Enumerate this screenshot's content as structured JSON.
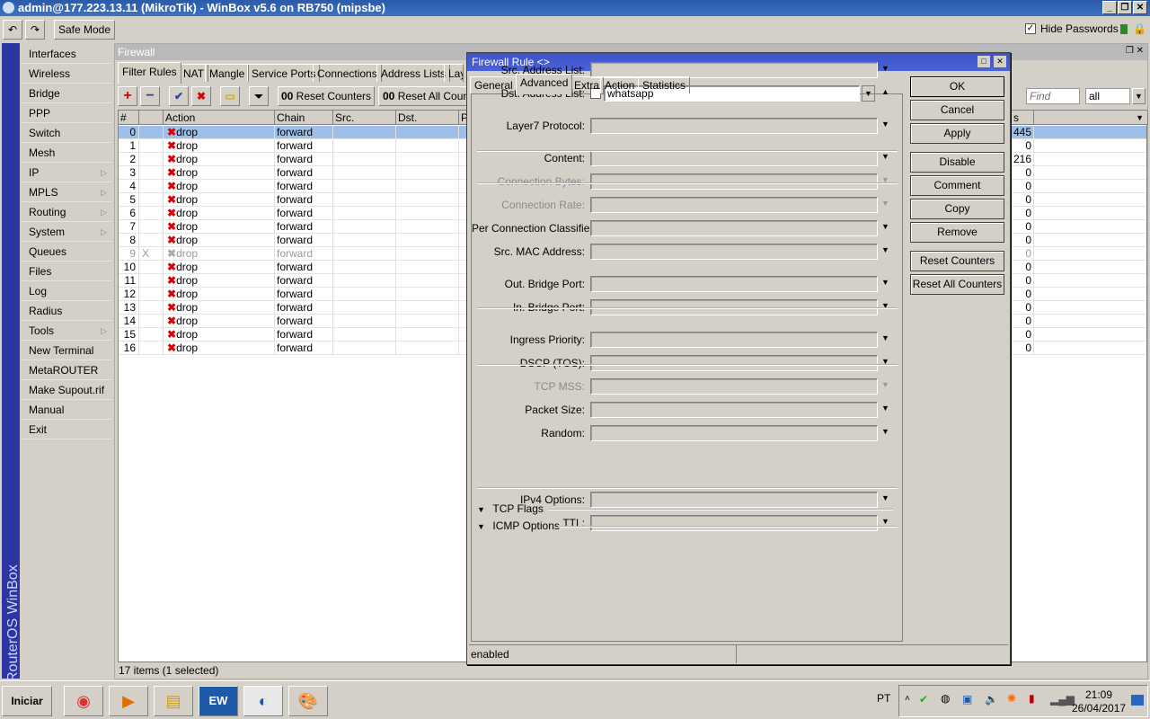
{
  "window": {
    "title": "admin@177.223.13.11 (MikroTik) - WinBox v5.6 on RB750 (mipsbe)"
  },
  "toolbar": {
    "safe_mode": "Safe Mode",
    "hide_passwords": "Hide Passwords",
    "hide_passwords_checked": true
  },
  "brand": "RouterOS WinBox",
  "menu": [
    {
      "label": "Interfaces"
    },
    {
      "label": "Wireless"
    },
    {
      "label": "Bridge"
    },
    {
      "label": "PPP"
    },
    {
      "label": "Switch"
    },
    {
      "label": "Mesh"
    },
    {
      "label": "IP",
      "sub": true
    },
    {
      "label": "MPLS",
      "sub": true
    },
    {
      "label": "Routing",
      "sub": true
    },
    {
      "label": "System",
      "sub": true
    },
    {
      "label": "Queues"
    },
    {
      "label": "Files"
    },
    {
      "label": "Log"
    },
    {
      "label": "Radius"
    },
    {
      "label": "Tools",
      "sub": true
    },
    {
      "label": "New Terminal"
    },
    {
      "label": "MetaROUTER"
    },
    {
      "label": "Make Supout.rif"
    },
    {
      "label": "Manual"
    },
    {
      "label": "Exit"
    }
  ],
  "firewall": {
    "title": "Firewall",
    "tabs": [
      "Filter Rules",
      "NAT",
      "Mangle",
      "Service Ports",
      "Connections",
      "Address Lists",
      "Layer7 Protocols"
    ],
    "reset_counters": "Reset Counters",
    "reset_all_counters": "Reset All Counters",
    "counter_prefix": "00",
    "find_placeholder": "Find",
    "filter_value": "all",
    "columns": [
      "#",
      "",
      "Action",
      "Chain",
      "Src. Address",
      "Dst. Address",
      "P",
      "Bytes"
    ],
    "rows": [
      {
        "n": "0",
        "flag": "",
        "action": "drop",
        "chain": "forward",
        "bytes": "445",
        "selected": true
      },
      {
        "n": "1",
        "flag": "",
        "action": "drop",
        "chain": "forward",
        "bytes": "0"
      },
      {
        "n": "2",
        "flag": "",
        "action": "drop",
        "chain": "forward",
        "bytes": "216"
      },
      {
        "n": "3",
        "flag": "",
        "action": "drop",
        "chain": "forward",
        "bytes": "0"
      },
      {
        "n": "4",
        "flag": "",
        "action": "drop",
        "chain": "forward",
        "bytes": "0"
      },
      {
        "n": "5",
        "flag": "",
        "action": "drop",
        "chain": "forward",
        "bytes": "0"
      },
      {
        "n": "6",
        "flag": "",
        "action": "drop",
        "chain": "forward",
        "bytes": "0"
      },
      {
        "n": "7",
        "flag": "",
        "action": "drop",
        "chain": "forward",
        "bytes": "0"
      },
      {
        "n": "8",
        "flag": "",
        "action": "drop",
        "chain": "forward",
        "bytes": "0"
      },
      {
        "n": "9",
        "flag": "X",
        "action": "drop",
        "chain": "forward",
        "bytes": "0",
        "disabled": true
      },
      {
        "n": "10",
        "flag": "",
        "action": "drop",
        "chain": "forward",
        "bytes": "0"
      },
      {
        "n": "11",
        "flag": "",
        "action": "drop",
        "chain": "forward",
        "bytes": "0"
      },
      {
        "n": "12",
        "flag": "",
        "action": "drop",
        "chain": "forward",
        "bytes": "0"
      },
      {
        "n": "13",
        "flag": "",
        "action": "drop",
        "chain": "forward",
        "bytes": "0"
      },
      {
        "n": "14",
        "flag": "",
        "action": "drop",
        "chain": "forward",
        "bytes": "0"
      },
      {
        "n": "15",
        "flag": "",
        "action": "drop",
        "chain": "forward",
        "bytes": "0"
      },
      {
        "n": "16",
        "flag": "",
        "action": "drop",
        "chain": "forward",
        "bytes": "0"
      }
    ],
    "status": "17 items (1 selected)"
  },
  "dialog": {
    "title": "Firewall Rule <>",
    "tabs": [
      "General",
      "Advanced",
      "Extra",
      "Action",
      "Statistics"
    ],
    "active_tab": "Advanced",
    "fields": [
      {
        "label": "Src. Address List:",
        "value": ""
      },
      {
        "label": "Dst. Address List:",
        "value": "whatsapp",
        "negate": false
      },
      {
        "label": "Layer7 Protocol:",
        "value": ""
      },
      {
        "label": "Content:",
        "value": ""
      },
      {
        "label": "Connection Bytes:",
        "value": "",
        "disabled": true
      },
      {
        "label": "Connection Rate:",
        "value": "",
        "disabled": true
      },
      {
        "label": "Per Connection Classifier:",
        "value": ""
      },
      {
        "label": "Src. MAC Address:",
        "value": ""
      },
      {
        "label": "Out. Bridge Port:",
        "value": ""
      },
      {
        "label": "In. Bridge Port:",
        "value": ""
      },
      {
        "label": "Ingress Priority:",
        "value": ""
      },
      {
        "label": "DSCP (TOS):",
        "value": ""
      },
      {
        "label": "TCP MSS:",
        "value": "",
        "disabled": true
      },
      {
        "label": "Packet Size:",
        "value": ""
      },
      {
        "label": "Random:",
        "value": ""
      },
      {
        "label": "IPv4 Options:",
        "value": ""
      },
      {
        "label": "TTL:",
        "value": ""
      }
    ],
    "sections": [
      "TCP Flags",
      "ICMP Options"
    ],
    "buttons": [
      "OK",
      "Cancel",
      "Apply",
      "Disable",
      "Comment",
      "Copy",
      "Remove",
      "Reset Counters",
      "Reset All Counters"
    ],
    "status": "enabled"
  },
  "taskbar": {
    "start": "Iniciar",
    "language": "PT",
    "time": "21:09",
    "date": "26/04/2017"
  }
}
